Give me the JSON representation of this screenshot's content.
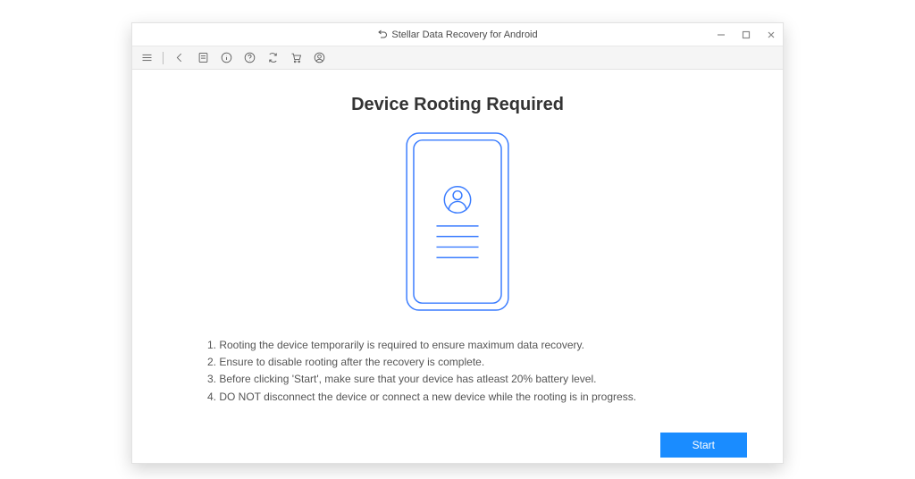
{
  "titlebar": {
    "title": "Stellar Data Recovery for Android"
  },
  "content": {
    "heading": "Device Rooting Required",
    "instructions": [
      "1. Rooting the device temporarily is required to ensure maximum data recovery.",
      "2. Ensure to disable rooting after the recovery is complete.",
      "3. Before clicking 'Start', make sure that your device has atleast 20% battery level.",
      "4. DO NOT disconnect the device or connect a new device while the rooting is in progress."
    ]
  },
  "buttons": {
    "start": "Start"
  },
  "colors": {
    "accent": "#1a8cff",
    "phoneStroke": "#3a7cff"
  }
}
